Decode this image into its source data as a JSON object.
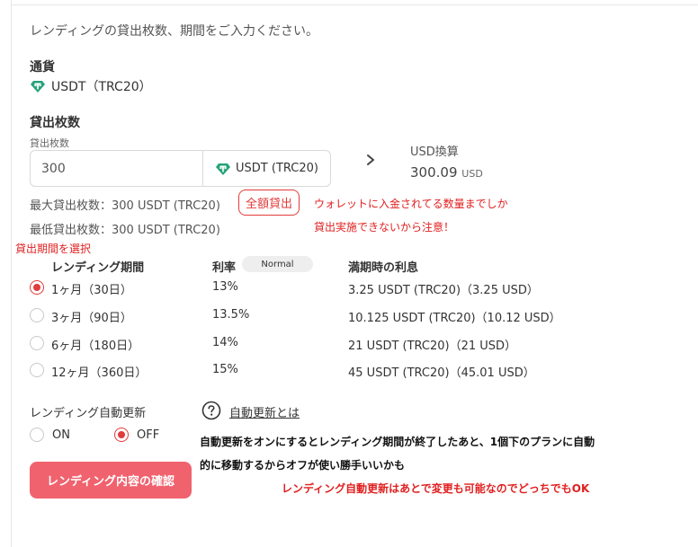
{
  "intro": "レンディングの貸出枚数、期間をご入力ください。",
  "currency": {
    "label": "通貨",
    "value": "USDT（TRC20）",
    "icon": "tether-icon"
  },
  "amount": {
    "label": "貸出枚数",
    "sublabel": "貸出枚数",
    "value": "300",
    "unit": "USDT (TRC20)",
    "usd_label": "USD換算",
    "usd_value": "300.09",
    "usd_unit": "USD"
  },
  "limits": {
    "max": "最大貸出枚数：300 USDT (TRC20)",
    "min": "最低貸出枚数：300 USDT (TRC20)",
    "full_button": "全額貸出"
  },
  "annotations": {
    "warning_line1": "ウォレットに入金されてる数量までしか",
    "warning_line2": "貸出実施できないから注意！",
    "period_note": "貸出期間を選択",
    "auto_note_line1": "自動更新をオンにするとレンディング期間が終了したあと、1個下のプランに自動",
    "auto_note_line2": "的に移動するからオフが使い勝手いいかも",
    "auto_note_line3": "レンディング自動更新はあとで変更も可能なのでどっちでもOK"
  },
  "table": {
    "headers": {
      "period": "レンディング期間",
      "rate": "利率",
      "rate_badge": "Normal",
      "interest": "満期時の利息"
    },
    "rows": [
      {
        "period": "1ヶ月（30日）",
        "rate": "13%",
        "interest": "3.25 USDT (TRC20)（3.25 USD）",
        "selected": true
      },
      {
        "period": "3ヶ月（90日）",
        "rate": "13.5%",
        "interest": "10.125 USDT (TRC20)（10.12 USD）",
        "selected": false
      },
      {
        "period": "6ヶ月（180日）",
        "rate": "14%",
        "interest": "21 USDT (TRC20)（21 USD）",
        "selected": false
      },
      {
        "period": "12ヶ月（360日）",
        "rate": "15%",
        "interest": "45 USDT (TRC20)（45.01 USD）",
        "selected": false
      }
    ]
  },
  "auto_renew": {
    "label": "レンディング自動更新",
    "on": "ON",
    "off": "OFF",
    "selected": "OFF",
    "link": "自動更新とは"
  },
  "confirm_button": "レンディング内容の確認",
  "colors": {
    "accent": "#e23b3b",
    "button": "#f0626e",
    "tether": "#26a17b",
    "annotation_red": "#e02020"
  }
}
